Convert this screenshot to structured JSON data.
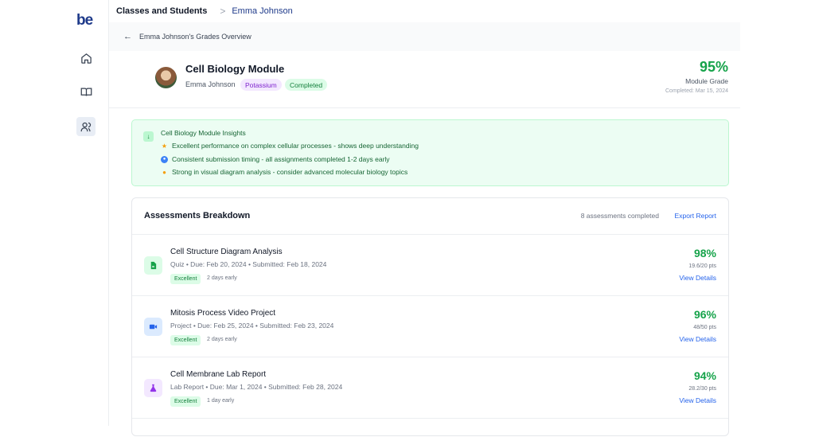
{
  "app": {
    "logo": "be"
  },
  "sidebar": {
    "items": [
      {
        "name": "home",
        "icon": "home-icon"
      },
      {
        "name": "book",
        "icon": "book-icon"
      },
      {
        "name": "users",
        "icon": "users-icon",
        "active": true
      }
    ]
  },
  "breadcrumb": {
    "root": "Classes and Students",
    "separator": ">",
    "current": "Emma Johnson"
  },
  "back": {
    "label": "Emma Johnson's Grades Overview"
  },
  "module": {
    "title": "Cell Biology Module",
    "student": "Emma Johnson",
    "house": "Potassium",
    "status": "Completed",
    "grade": "95%",
    "grade_label": "Module Grade",
    "completed_date": "Completed: Mar 15, 2024"
  },
  "insights": {
    "title": "Cell Biology Module Insights",
    "items": [
      {
        "icon": "star-icon",
        "text": "Excellent performance on complex cellular processes - shows deep understanding"
      },
      {
        "icon": "clock-icon",
        "text": "Consistent submission timing - all assignments completed 1-2 days early"
      },
      {
        "icon": "lightbulb-icon",
        "text": "Strong in visual diagram analysis - consider advanced molecular biology topics"
      }
    ]
  },
  "assessments": {
    "title": "Assessments Breakdown",
    "count": "8 assessments completed",
    "export": "Export Report",
    "items": [
      {
        "title": "Cell Structure Diagram Analysis",
        "meta": "Quiz • Due: Feb 20, 2024 • Submitted: Feb 18, 2024",
        "badge": "Excellent",
        "timing": "2 days early",
        "score": "98%",
        "pts": "19.6/20 pts",
        "details": "View Details",
        "icon": "document-icon",
        "icon_bg": "#dcfce7",
        "icon_fg": "#16a34a"
      },
      {
        "title": "Mitosis Process Video Project",
        "meta": "Project • Due: Feb 25, 2024 • Submitted: Feb 23, 2024",
        "badge": "Excellent",
        "timing": "2 days early",
        "score": "96%",
        "pts": "48/50 pts",
        "details": "View Details",
        "icon": "video-icon",
        "icon_bg": "#dbeafe",
        "icon_fg": "#2563eb"
      },
      {
        "title": "Cell Membrane Lab Report",
        "meta": "Lab Report • Due: Mar 1, 2024 • Submitted: Feb 28, 2024",
        "badge": "Excellent",
        "timing": "1 day early",
        "score": "94%",
        "pts": "28.2/30 pts",
        "details": "View Details",
        "icon": "flask-icon",
        "icon_bg": "#f3e8ff",
        "icon_fg": "#9333ea"
      }
    ]
  }
}
